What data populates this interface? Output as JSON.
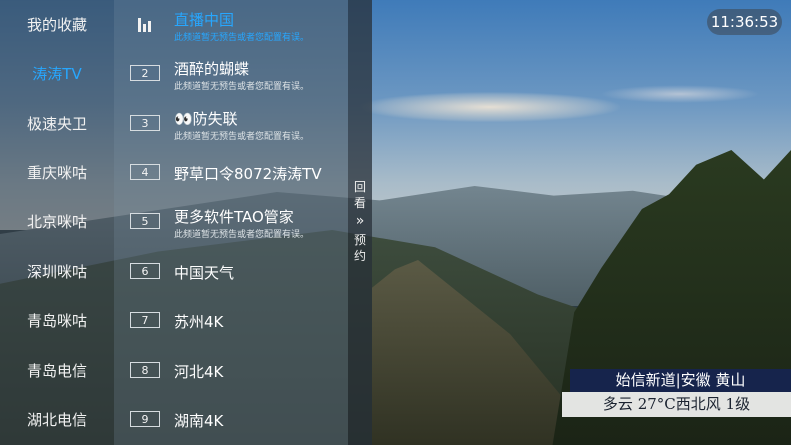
{
  "clock": "11:36:53",
  "categories": [
    {
      "label": "我的收藏",
      "active": false
    },
    {
      "label": "涛涛TV",
      "active": true
    },
    {
      "label": "极速央卫",
      "active": false
    },
    {
      "label": "重庆咪咕",
      "active": false
    },
    {
      "label": "北京咪咕",
      "active": false
    },
    {
      "label": "深圳咪咕",
      "active": false
    },
    {
      "label": "青岛咪咕",
      "active": false
    },
    {
      "label": "青岛电信",
      "active": false
    },
    {
      "label": "湖北电信",
      "active": false
    }
  ],
  "channels": [
    {
      "num": "",
      "name": "直播中国",
      "sub": "此频道暂无预告或者您配置有误。",
      "active": true,
      "icon": "playing-bars-icon"
    },
    {
      "num": "2",
      "name": "酒醉的蝴蝶",
      "sub": "此频道暂无预告或者您配置有误。"
    },
    {
      "num": "3",
      "name": "👀防失联",
      "sub": "此频道暂无预告或者您配置有误。"
    },
    {
      "num": "4",
      "name": "野草口令8072涛涛TV",
      "sub": ""
    },
    {
      "num": "5",
      "name": "更多软件TAO管家",
      "sub": "此频道暂无预告或者您配置有误。"
    },
    {
      "num": "6",
      "name": "中国天气",
      "sub": ""
    },
    {
      "num": "7",
      "name": "苏州4K",
      "sub": ""
    },
    {
      "num": "8",
      "name": "河北4K",
      "sub": ""
    },
    {
      "num": "9",
      "name": "湖南4K",
      "sub": ""
    }
  ],
  "rail": {
    "top": "回看",
    "arrow": "»",
    "bottom": "预约"
  },
  "weather": {
    "line1": "始信新道|安徽 黄山",
    "line2": "多云 27°C西北风 1级"
  },
  "colors": {
    "accent": "#27a7ff"
  }
}
